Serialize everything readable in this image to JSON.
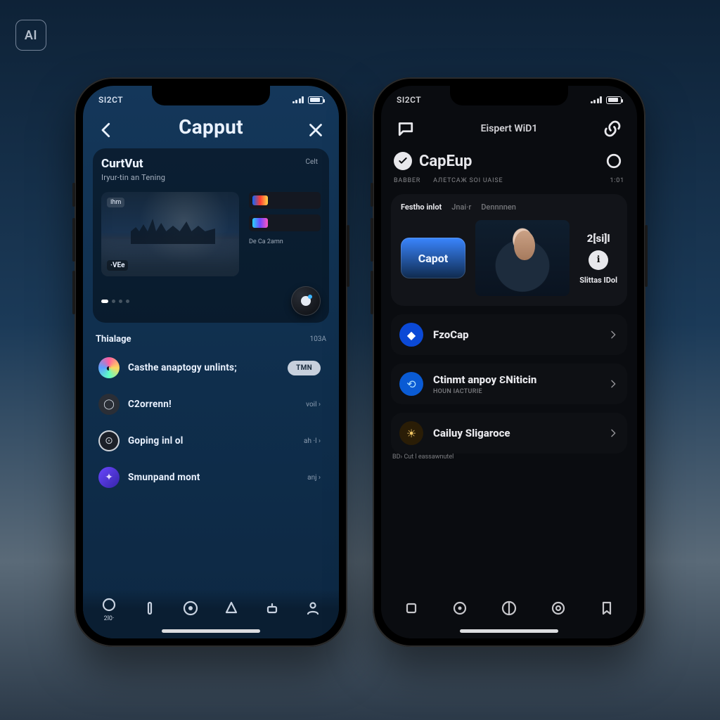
{
  "badge": "AI",
  "left": {
    "status_time": "SI2CT",
    "header_title": "Capput",
    "card": {
      "title": "CurtVut",
      "subtitle": "Iryur-tin an Tening",
      "meta": "Celt",
      "thumb_tag": "Ihm",
      "thumb_duration": "·VEe",
      "clip1": "",
      "clip2": "",
      "clip_caption": "De Ca 2amn"
    },
    "section": {
      "title": "Thialage",
      "more": "103A"
    },
    "rows": [
      {
        "label": "Casthe anaptogy unlints;",
        "meta": "TMN"
      },
      {
        "label": "C2orrenn!",
        "meta": "voil ›"
      },
      {
        "label": "Goping inl ol",
        "meta": "ah ·l ›"
      },
      {
        "label": "Smunpand  mont",
        "meta": "anj ›"
      }
    ],
    "tabs": [
      {
        "label": "2l0·"
      },
      {
        "label": ""
      },
      {
        "label": ""
      },
      {
        "label": ""
      },
      {
        "label": ""
      },
      {
        "label": ""
      }
    ]
  },
  "right": {
    "status_time": "SI2CT",
    "header_title": "Eispert WiD1",
    "brand": "CapEup",
    "tabs_top": [
      "BАВBER",
      "АЛЕТСАЖ SOI UAІSE"
    ],
    "tabs_top_right": "1:01",
    "feature": {
      "tab_active": "Festho inlot",
      "tab_dim1": "Jnai·r",
      "tab_dim2": "Dennnnen",
      "chip": "Capot",
      "meta_big": "2[si]l",
      "meta_small": "Slittas IDol"
    },
    "rows": [
      {
        "label": "FzoCap",
        "sub": ""
      },
      {
        "label": "Ctinmt anpoy ƐNiticin",
        "sub": "HOUN IACTURIE"
      },
      {
        "label": "Cailuy Sligaroce",
        "sub": ""
      }
    ],
    "footer_line": "BD›  Cut l eassawnutel",
    "tabs": [
      "",
      "",
      "",
      "",
      ""
    ]
  }
}
